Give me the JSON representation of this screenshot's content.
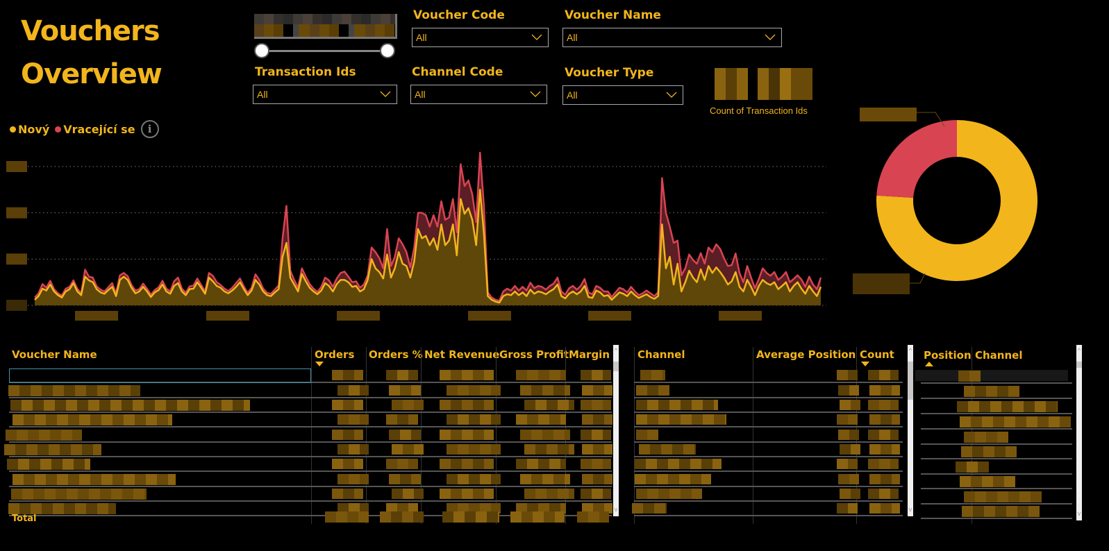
{
  "page": {
    "title_line1": "Vouchers",
    "title_line2": "Overview"
  },
  "colors": {
    "accent": "#F2B51C",
    "series_new": "#F2B51C",
    "series_returning": "#D94452",
    "background": "#000000",
    "area_new_fill": "#5E4709",
    "area_returning_fill": "#5A1E24"
  },
  "slicers": {
    "date_range": {
      "label_redacted": true,
      "lower": 0,
      "upper": 1
    },
    "voucher_code": {
      "label": "Voucher Code",
      "value": "All"
    },
    "voucher_name": {
      "label": "Voucher Name",
      "value": "All"
    },
    "transaction_ids": {
      "label": "Transaction Ids",
      "value": "All"
    },
    "channel_code": {
      "label": "Channel Code",
      "value": "All"
    },
    "voucher_type": {
      "label": "Voucher Type",
      "value": "All"
    }
  },
  "kpi": {
    "label": "Count of Transaction Ids",
    "value": "redacted"
  },
  "legend": {
    "items": [
      {
        "label": "Nový",
        "color": "#F2B51C"
      },
      {
        "label": "Vracející se",
        "color": "#D94452"
      }
    ],
    "info_icon": "info-icon"
  },
  "chart_data": [
    {
      "type": "area",
      "stacked": true,
      "title": "",
      "xlabel": "",
      "ylabel": "",
      "y_tick_labels": "redacted",
      "x_tick_labels": "redacted",
      "y_gridlines": [
        0,
        1,
        2,
        3
      ],
      "ylim": [
        0,
        3.3
      ],
      "legend_position": "top-left",
      "series": [
        {
          "name": "Nový",
          "color": "#F2B51C",
          "values": [
            0.12,
            0.2,
            0.36,
            0.32,
            0.45,
            0.3,
            0.22,
            0.17,
            0.3,
            0.35,
            0.48,
            0.3,
            0.22,
            0.62,
            0.54,
            0.5,
            0.35,
            0.28,
            0.25,
            0.33,
            0.4,
            0.2,
            0.55,
            0.62,
            0.55,
            0.38,
            0.26,
            0.3,
            0.4,
            0.3,
            0.18,
            0.28,
            0.33,
            0.45,
            0.3,
            0.25,
            0.42,
            0.48,
            0.3,
            0.22,
            0.35,
            0.36,
            0.5,
            0.38,
            0.25,
            0.6,
            0.52,
            0.42,
            0.38,
            0.3,
            0.26,
            0.32,
            0.4,
            0.5,
            0.35,
            0.22,
            0.32,
            0.55,
            0.45,
            0.3,
            0.22,
            0.2,
            0.28,
            0.35,
            1.05,
            1.35,
            0.6,
            0.45,
            0.3,
            0.68,
            0.52,
            0.38,
            0.3,
            0.24,
            0.32,
            0.48,
            0.42,
            0.3,
            0.46,
            0.55,
            0.55,
            0.5,
            0.4,
            0.42,
            0.3,
            0.35,
            0.55,
            1.0,
            0.8,
            0.72,
            0.58,
            1.1,
            0.6,
            0.8,
            1.15,
            0.9,
            0.85,
            0.6,
            0.95,
            1.65,
            1.45,
            1.5,
            1.3,
            1.45,
            1.2,
            1.75,
            1.3,
            1.4,
            1.75,
            1.08,
            2.3,
            1.98,
            2.1,
            1.85,
            1.3,
            2.5,
            1.55,
            0.2,
            0.12,
            0.08,
            0.06,
            0.2,
            0.24,
            0.22,
            0.3,
            0.22,
            0.28,
            0.2,
            0.34,
            0.25,
            0.3,
            0.28,
            0.24,
            0.3,
            0.35,
            0.45,
            0.2,
            0.15,
            0.25,
            0.3,
            0.24,
            0.3,
            0.42,
            0.18,
            0.16,
            0.32,
            0.28,
            0.2,
            0.22,
            0.12,
            0.2,
            0.28,
            0.25,
            0.2,
            0.3,
            0.22,
            0.16,
            0.2,
            0.24,
            0.18,
            0.14,
            0.2,
            1.75,
            0.8,
            1.05,
            0.45,
            0.9,
            0.3,
            0.5,
            0.75,
            0.6,
            0.5,
            0.78,
            0.55,
            0.85,
            0.7,
            0.82,
            0.72,
            0.6,
            0.45,
            0.52,
            0.72,
            0.4,
            0.3,
            0.55,
            0.4,
            0.22,
            0.42,
            0.55,
            0.48,
            0.44,
            0.5,
            0.35,
            0.42,
            0.5,
            0.3,
            0.42,
            0.5,
            0.36,
            0.25,
            0.42,
            0.3,
            0.2,
            0.4
          ]
        },
        {
          "name": "Vracející se",
          "color": "#D94452",
          "values": [
            0.05,
            0.06,
            0.1,
            0.06,
            0.08,
            0.05,
            0.04,
            0.04,
            0.06,
            0.05,
            0.06,
            0.06,
            0.04,
            0.15,
            0.08,
            0.1,
            0.06,
            0.06,
            0.05,
            0.06,
            0.08,
            0.06,
            0.1,
            0.08,
            0.08,
            0.06,
            0.06,
            0.05,
            0.07,
            0.06,
            0.05,
            0.05,
            0.06,
            0.08,
            0.06,
            0.05,
            0.1,
            0.12,
            0.06,
            0.05,
            0.06,
            0.07,
            0.08,
            0.06,
            0.05,
            0.1,
            0.12,
            0.08,
            0.06,
            0.06,
            0.05,
            0.06,
            0.08,
            0.08,
            0.06,
            0.05,
            0.06,
            0.12,
            0.1,
            0.06,
            0.05,
            0.05,
            0.06,
            0.08,
            0.4,
            0.8,
            0.15,
            0.1,
            0.08,
            0.12,
            0.1,
            0.08,
            0.06,
            0.05,
            0.08,
            0.12,
            0.12,
            0.1,
            0.12,
            0.15,
            0.18,
            0.12,
            0.1,
            0.1,
            0.08,
            0.1,
            0.1,
            0.25,
            0.35,
            0.3,
            0.22,
            0.55,
            0.25,
            0.25,
            0.3,
            0.42,
            0.3,
            0.22,
            0.3,
            0.35,
            0.55,
            0.45,
            0.4,
            0.5,
            0.5,
            0.5,
            0.55,
            0.5,
            0.55,
            0.5,
            0.75,
            0.6,
            0.6,
            0.55,
            0.5,
            0.8,
            0.6,
            0.08,
            0.05,
            0.04,
            0.04,
            0.1,
            0.12,
            0.1,
            0.12,
            0.1,
            0.12,
            0.12,
            0.15,
            0.12,
            0.12,
            0.12,
            0.1,
            0.12,
            0.12,
            0.15,
            0.1,
            0.08,
            0.12,
            0.12,
            0.1,
            0.12,
            0.15,
            0.1,
            0.08,
            0.1,
            0.1,
            0.1,
            0.08,
            0.06,
            0.08,
            0.1,
            0.1,
            0.08,
            0.1,
            0.08,
            0.06,
            0.06,
            0.08,
            0.08,
            0.06,
            0.08,
            1.0,
            1.2,
            0.65,
            0.9,
            0.5,
            0.35,
            0.3,
            0.35,
            0.38,
            0.4,
            0.35,
            0.35,
            0.4,
            0.45,
            0.5,
            0.5,
            0.42,
            0.4,
            0.35,
            0.4,
            0.3,
            0.2,
            0.3,
            0.2,
            0.15,
            0.15,
            0.25,
            0.22,
            0.2,
            0.22,
            0.2,
            0.2,
            0.22,
            0.2,
            0.15,
            0.15,
            0.2,
            0.15,
            0.2,
            0.15,
            0.15,
            0.2
          ]
        }
      ]
    },
    {
      "type": "pie",
      "donut": true,
      "title": "",
      "labels": [
        "Vracející se",
        "Nový"
      ],
      "values": [
        24,
        76
      ],
      "colors": [
        "#D94452",
        "#F2B51C"
      ],
      "data_labels": "redacted"
    }
  ],
  "tables": {
    "vouchers": {
      "columns": [
        {
          "label": "Voucher Name"
        },
        {
          "label": "Orders",
          "sort": "desc"
        },
        {
          "label": "Orders %"
        },
        {
          "label": "Net Revenue"
        },
        {
          "label": "Gross Profit"
        },
        {
          "label": "Margin"
        }
      ],
      "row_count_visible": 10,
      "cell_values": "redacted",
      "total_label": "Total"
    },
    "channels": {
      "columns": [
        {
          "label": "Channel"
        },
        {
          "label": "Average Position"
        },
        {
          "label": "Count",
          "sort": "desc"
        }
      ],
      "row_count_visible": 10,
      "cell_values": "redacted"
    },
    "positions": {
      "columns": [
        {
          "label": "Position",
          "sort": "asc"
        },
        {
          "label": "Channel"
        }
      ],
      "row_count_visible": 10,
      "cell_values": "redacted"
    }
  }
}
